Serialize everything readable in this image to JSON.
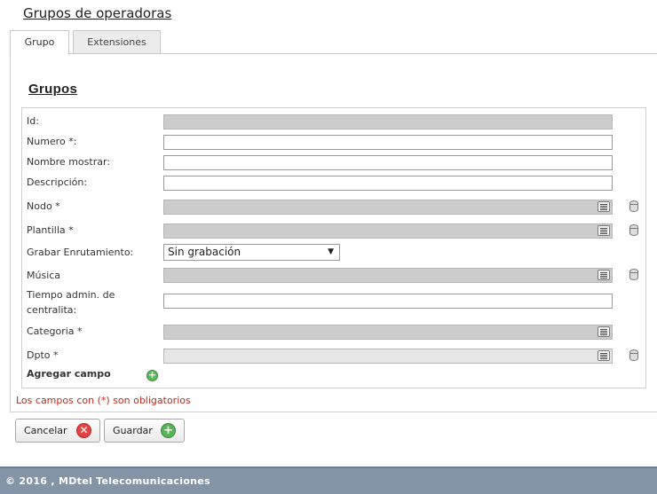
{
  "page": {
    "title": "Grupos de operadoras"
  },
  "tabs": [
    {
      "label": "Grupo",
      "active": true
    },
    {
      "label": "Extensiones",
      "active": false
    }
  ],
  "section": {
    "title": "Grupos"
  },
  "form": {
    "id_label": "Id:",
    "numero_label": "Numero *:",
    "nombre_label": "Nombre mostrar:",
    "descripcion_label": "Descripción:",
    "nodo_label": "Nodo *",
    "plantilla_label": "Plantilla *",
    "grabar_label": "Grabar Enrutamiento:",
    "grabar_value": "Sin grabación",
    "musica_label": "Música",
    "tiempo_label_1": "Tiempo admin. de",
    "tiempo_label_2": "centralita:",
    "categoria_label": "Categoria *",
    "dpto_label": "Dpto *",
    "agregar_label": "Agregar campo"
  },
  "required_note": "Los campos con (*) son obligatorios",
  "buttons": {
    "cancel": "Cancelar",
    "save": "Guardar"
  },
  "footer": {
    "text": "© 2016 , MDtel Telecomunicaciones"
  },
  "colors": {
    "footer_bg": "#8394a6",
    "required_text": "#c0281e",
    "disabled_field": "#cccccc"
  }
}
